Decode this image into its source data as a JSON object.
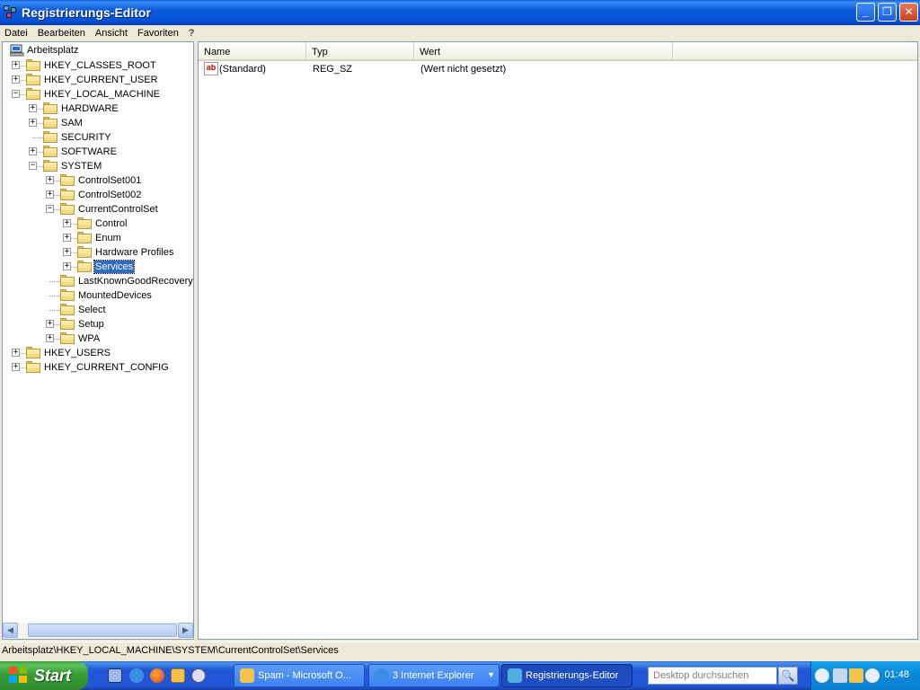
{
  "window": {
    "title": "Registrierungs-Editor",
    "minimize": "_",
    "restore": "❐",
    "close": "✕"
  },
  "menu": [
    "Datei",
    "Bearbeiten",
    "Ansicht",
    "Favoriten",
    "?"
  ],
  "tree": {
    "root": "Arbeitsplatz",
    "nodes": [
      {
        "label": "HKEY_CLASSES_ROOT",
        "level": 1,
        "expander": "+"
      },
      {
        "label": "HKEY_CURRENT_USER",
        "level": 1,
        "expander": "+"
      },
      {
        "label": "HKEY_LOCAL_MACHINE",
        "level": 1,
        "expander": "−"
      },
      {
        "label": "HARDWARE",
        "level": 2,
        "expander": "+"
      },
      {
        "label": "SAM",
        "level": 2,
        "expander": "+"
      },
      {
        "label": "SECURITY",
        "level": 2,
        "expander": ""
      },
      {
        "label": "SOFTWARE",
        "level": 2,
        "expander": "+"
      },
      {
        "label": "SYSTEM",
        "level": 2,
        "expander": "−"
      },
      {
        "label": "ControlSet001",
        "level": 3,
        "expander": "+"
      },
      {
        "label": "ControlSet002",
        "level": 3,
        "expander": "+"
      },
      {
        "label": "CurrentControlSet",
        "level": 3,
        "expander": "−"
      },
      {
        "label": "Control",
        "level": 4,
        "expander": "+"
      },
      {
        "label": "Enum",
        "level": 4,
        "expander": "+"
      },
      {
        "label": "Hardware Profiles",
        "level": 4,
        "expander": "+"
      },
      {
        "label": "Services",
        "level": 4,
        "expander": "+",
        "selected": true
      },
      {
        "label": "LastKnownGoodRecovery",
        "level": 3,
        "expander": ""
      },
      {
        "label": "MountedDevices",
        "level": 3,
        "expander": ""
      },
      {
        "label": "Select",
        "level": 3,
        "expander": ""
      },
      {
        "label": "Setup",
        "level": 3,
        "expander": "+"
      },
      {
        "label": "WPA",
        "level": 3,
        "expander": "+"
      },
      {
        "label": "HKEY_USERS",
        "level": 1,
        "expander": "+"
      },
      {
        "label": "HKEY_CURRENT_CONFIG",
        "level": 1,
        "expander": "+"
      }
    ]
  },
  "list": {
    "columns": [
      "Name",
      "Typ",
      "Wert"
    ],
    "rows": [
      {
        "icon": "ab",
        "name": "(Standard)",
        "type": "REG_SZ",
        "value": "(Wert nicht gesetzt)"
      }
    ]
  },
  "scroll": {
    "left": "◀",
    "right": "▶"
  },
  "status": {
    "path": "Arbeitsplatz\\HKEY_LOCAL_MACHINE\\SYSTEM\\CurrentControlSet\\Services"
  },
  "taskbar": {
    "start": "Start",
    "tasks": [
      {
        "label": "Spam - Microsoft O...",
        "active": false,
        "arrow": ""
      },
      {
        "label": "3 Internet Explorer",
        "active": false,
        "arrow": "▼"
      },
      {
        "label": "Registrierungs-Editor",
        "active": true,
        "arrow": ""
      }
    ],
    "search_placeholder": "Desktop durchsuchen",
    "search_button": "🔍",
    "clock": "01:48"
  },
  "colors": {
    "selection": "#316ac5",
    "titlebar": "#0b5bdc",
    "taskbar": "#2157d7",
    "start": "#379e37",
    "tray": "#0d8ad8"
  },
  "icons": {
    "quicklaunch": [
      "show-desktop-icon",
      "internet-explorer-icon",
      "firefox-icon",
      "outlook-icon",
      "media-player-icon"
    ],
    "tray": [
      "chevron-left-icon",
      "network-icon",
      "outlook-tray-icon",
      "search-tray-icon"
    ]
  }
}
